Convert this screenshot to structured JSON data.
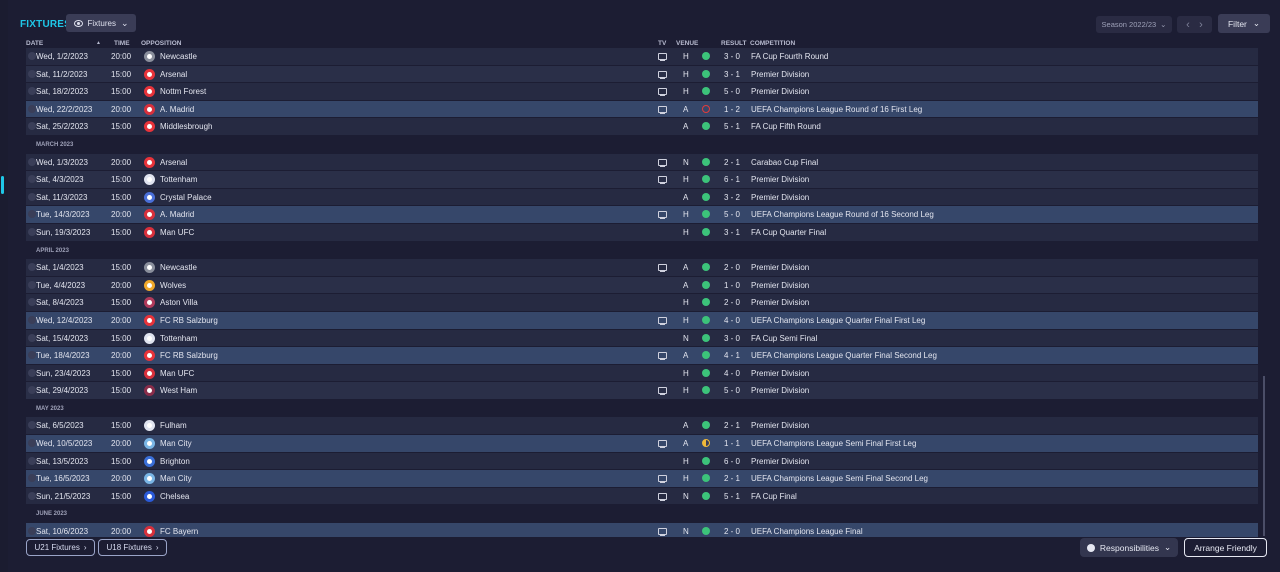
{
  "header": {
    "title": "FIXTURES",
    "view_dropdown": "Fixtures",
    "season": "Season 2022/23",
    "filter": "Filter"
  },
  "columns": {
    "date": "DATE",
    "time": "TIME",
    "opposition": "OPPOSITION",
    "tv": "TV",
    "venue": "VENUE",
    "result": "RESULT",
    "competition": "COMPETITION"
  },
  "colors": {
    "accent": "#1fc7e8",
    "win": "#3cc37a",
    "loss": "#e23b3b",
    "draw": "#f0b93a"
  },
  "rows": [
    {
      "kind": "match",
      "date": "Wed, 1/2/2023",
      "time": "20:00",
      "opp": "Newcastle",
      "crest": "#8a8f9c",
      "tv": true,
      "venue": "H",
      "res": "W",
      "score": "3 - 0",
      "comp": "FA Cup Fourth Round",
      "hl": false
    },
    {
      "kind": "match",
      "date": "Sat, 11/2/2023",
      "time": "15:00",
      "opp": "Arsenal",
      "crest": "#e8333a",
      "tv": true,
      "venue": "H",
      "res": "W",
      "score": "3 - 1",
      "comp": "Premier Division",
      "hl": false
    },
    {
      "kind": "match",
      "date": "Sat, 18/2/2023",
      "time": "15:00",
      "opp": "Nottm Forest",
      "crest": "#e8333a",
      "tv": true,
      "venue": "H",
      "res": "W",
      "score": "5 - 0",
      "comp": "Premier Division",
      "hl": false
    },
    {
      "kind": "match",
      "date": "Wed, 22/2/2023",
      "time": "20:00",
      "opp": "A. Madrid",
      "crest": "#d8303c",
      "tv": true,
      "venue": "A",
      "res": "L",
      "score": "1 - 2",
      "comp": "UEFA Champions League Round of 16  First Leg",
      "hl": true
    },
    {
      "kind": "match",
      "date": "Sat, 25/2/2023",
      "time": "15:00",
      "opp": "Middlesbrough",
      "crest": "#e8333a",
      "tv": false,
      "venue": "A",
      "res": "W",
      "score": "5 - 1",
      "comp": "FA Cup Fifth Round",
      "hl": false
    },
    {
      "kind": "month",
      "label": "MARCH 2023"
    },
    {
      "kind": "match",
      "date": "Wed, 1/3/2023",
      "time": "20:00",
      "opp": "Arsenal",
      "crest": "#e8333a",
      "tv": true,
      "venue": "N",
      "res": "W",
      "score": "2 - 1",
      "comp": "Carabao Cup Final",
      "hl": false
    },
    {
      "kind": "match",
      "date": "Sat, 4/3/2023",
      "time": "15:00",
      "opp": "Tottenham",
      "crest": "#e0e4f0",
      "tv": true,
      "venue": "H",
      "res": "W",
      "score": "6 - 1",
      "comp": "Premier Division",
      "hl": false
    },
    {
      "kind": "match",
      "date": "Sat, 11/3/2023",
      "time": "15:00",
      "opp": "Crystal Palace",
      "crest": "#4a6fd8",
      "tv": false,
      "venue": "A",
      "res": "W",
      "score": "3 - 2",
      "comp": "Premier Division",
      "hl": false
    },
    {
      "kind": "match",
      "date": "Tue, 14/3/2023",
      "time": "20:00",
      "opp": "A. Madrid",
      "crest": "#d8303c",
      "tv": true,
      "venue": "H",
      "res": "W",
      "score": "5 - 0",
      "comp": "UEFA Champions League Round of 16  Second Leg",
      "hl": true
    },
    {
      "kind": "match",
      "date": "Sun, 19/3/2023",
      "time": "15:00",
      "opp": "Man UFC",
      "crest": "#d8303c",
      "tv": false,
      "venue": "H",
      "res": "W",
      "score": "3 - 1",
      "comp": "FA Cup Quarter Final",
      "hl": false
    },
    {
      "kind": "month",
      "label": "APRIL 2023"
    },
    {
      "kind": "match",
      "date": "Sat, 1/4/2023",
      "time": "15:00",
      "opp": "Newcastle",
      "crest": "#8a8f9c",
      "tv": true,
      "venue": "A",
      "res": "W",
      "score": "2 - 0",
      "comp": "Premier Division",
      "hl": false
    },
    {
      "kind": "match",
      "date": "Tue, 4/4/2023",
      "time": "20:00",
      "opp": "Wolves",
      "crest": "#f0a82a",
      "tv": false,
      "venue": "A",
      "res": "W",
      "score": "1 - 0",
      "comp": "Premier Division",
      "hl": false
    },
    {
      "kind": "match",
      "date": "Sat, 8/4/2023",
      "time": "15:00",
      "opp": "Aston Villa",
      "crest": "#b03a5b",
      "tv": false,
      "venue": "H",
      "res": "W",
      "score": "2 - 0",
      "comp": "Premier Division",
      "hl": false
    },
    {
      "kind": "match",
      "date": "Wed, 12/4/2023",
      "time": "20:00",
      "opp": "FC RB Salzburg",
      "crest": "#e8333a",
      "tv": true,
      "venue": "H",
      "res": "W",
      "score": "4 - 0",
      "comp": "UEFA Champions League Quarter Final First Leg",
      "hl": true
    },
    {
      "kind": "match",
      "date": "Sat, 15/4/2023",
      "time": "15:00",
      "opp": "Tottenham",
      "crest": "#e0e4f0",
      "tv": false,
      "venue": "N",
      "res": "W",
      "score": "3 - 0",
      "comp": "FA Cup Semi Final",
      "hl": false
    },
    {
      "kind": "match",
      "date": "Tue, 18/4/2023",
      "time": "20:00",
      "opp": "FC RB Salzburg",
      "crest": "#e8333a",
      "tv": true,
      "venue": "A",
      "res": "W",
      "score": "4 - 1",
      "comp": "UEFA Champions League Quarter Final Second Leg",
      "hl": true
    },
    {
      "kind": "match",
      "date": "Sun, 23/4/2023",
      "time": "15:00",
      "opp": "Man UFC",
      "crest": "#d8303c",
      "tv": false,
      "venue": "H",
      "res": "W",
      "score": "4 - 0",
      "comp": "Premier Division",
      "hl": false
    },
    {
      "kind": "match",
      "date": "Sat, 29/4/2023",
      "time": "15:00",
      "opp": "West Ham",
      "crest": "#8a2d4a",
      "tv": true,
      "venue": "H",
      "res": "W",
      "score": "5 - 0",
      "comp": "Premier Division",
      "hl": false
    },
    {
      "kind": "month",
      "label": "MAY 2023"
    },
    {
      "kind": "match",
      "date": "Sat, 6/5/2023",
      "time": "15:00",
      "opp": "Fulham",
      "crest": "#e0e4f0",
      "tv": false,
      "venue": "A",
      "res": "W",
      "score": "2 - 1",
      "comp": "Premier Division",
      "hl": false
    },
    {
      "kind": "match",
      "date": "Wed, 10/5/2023",
      "time": "20:00",
      "opp": "Man City",
      "crest": "#7ab6e6",
      "tv": true,
      "venue": "A",
      "res": "D",
      "score": "1 - 1",
      "comp": "UEFA Champions League Semi Final First Leg",
      "hl": true
    },
    {
      "kind": "match",
      "date": "Sat, 13/5/2023",
      "time": "15:00",
      "opp": "Brighton",
      "crest": "#3a6fd8",
      "tv": false,
      "venue": "H",
      "res": "W",
      "score": "6 - 0",
      "comp": "Premier Division",
      "hl": false
    },
    {
      "kind": "match",
      "date": "Tue, 16/5/2023",
      "time": "20:00",
      "opp": "Man City",
      "crest": "#7ab6e6",
      "tv": true,
      "venue": "H",
      "res": "W",
      "score": "2 - 1",
      "comp": "UEFA Champions League Semi Final Second Leg",
      "hl": true
    },
    {
      "kind": "match",
      "date": "Sun, 21/5/2023",
      "time": "15:00",
      "opp": "Chelsea",
      "crest": "#2a5ad8",
      "tv": true,
      "venue": "N",
      "res": "W",
      "score": "5 - 1",
      "comp": "FA Cup Final",
      "hl": false
    },
    {
      "kind": "month",
      "label": "JUNE 2023"
    },
    {
      "kind": "match",
      "date": "Sat, 10/6/2023",
      "time": "20:00",
      "opp": "FC Bayern",
      "crest": "#d8303c",
      "tv": true,
      "venue": "N",
      "res": "W",
      "score": "2 - 0",
      "comp": "UEFA Champions League Final",
      "hl": true
    }
  ],
  "footer": {
    "u21": "U21 Fixtures",
    "u18": "U18 Fixtures",
    "responsibilities": "Responsibilities",
    "arrange": "Arrange Friendly"
  }
}
